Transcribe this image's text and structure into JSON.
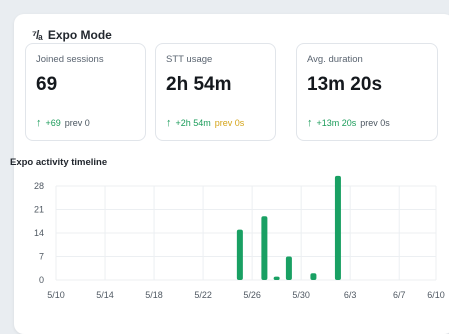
{
  "header": {
    "icon": "expo-icon",
    "icon_glyph": "⁷/ₐ",
    "title": "Expo Mode"
  },
  "cards": [
    {
      "label": "Joined sessions",
      "value": "69",
      "delta": "+69",
      "prev": "prev 0"
    },
    {
      "label": "STT usage",
      "value": "2h 54m",
      "delta": "+2h 54m",
      "prev": "prev 0s"
    },
    {
      "label": "Avg. duration",
      "value": "13m 20s",
      "delta": "+13m 20s",
      "prev": "prev 0s"
    }
  ],
  "colors": {
    "accent": "#1b9c5a",
    "bar": "#19a063"
  },
  "chart_data": {
    "type": "bar",
    "title": "Expo activity timeline",
    "x_ticks": [
      "5/10",
      "5/14",
      "5/18",
      "5/22",
      "5/26",
      "5/30",
      "6/3",
      "6/7",
      "6/10"
    ],
    "y_ticks": [
      "0",
      "7",
      "14",
      "21",
      "28"
    ],
    "ylim": [
      0,
      28
    ],
    "xlim": [
      "5/10",
      "6/10"
    ],
    "bars": [
      {
        "x": "5/25",
        "value": 15
      },
      {
        "x": "5/27",
        "value": 19
      },
      {
        "x": "5/28",
        "value": 1
      },
      {
        "x": "5/29",
        "value": 7
      },
      {
        "x": "5/31",
        "value": 2
      },
      {
        "x": "6/2",
        "value": 31
      }
    ],
    "grid": true
  }
}
